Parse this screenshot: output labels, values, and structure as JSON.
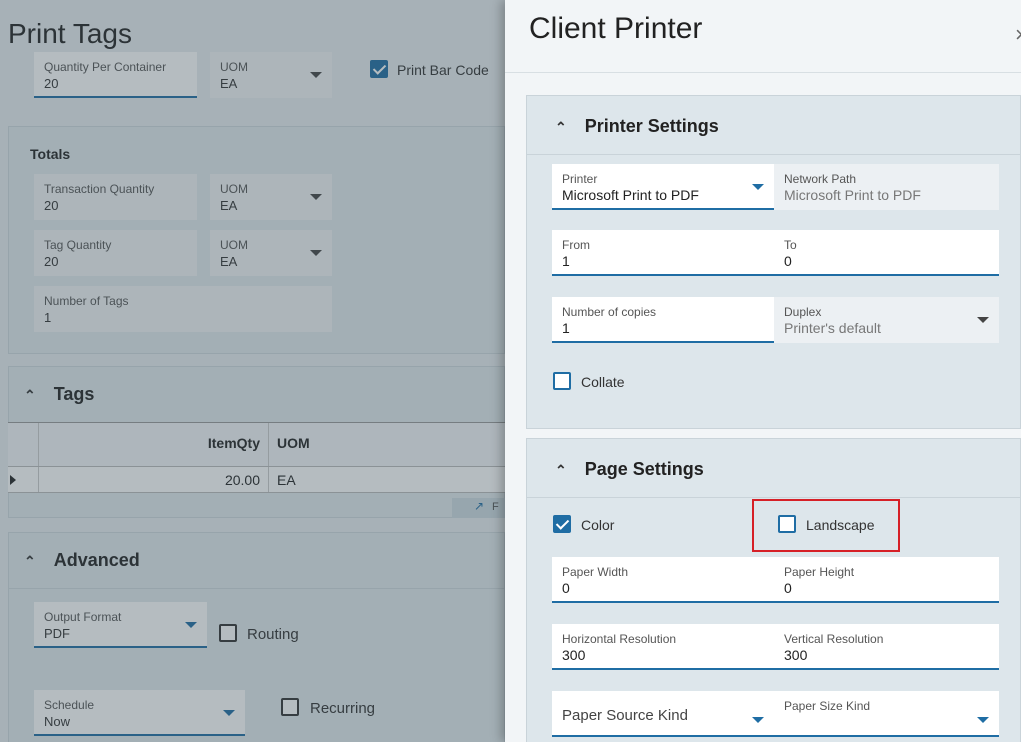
{
  "background": {
    "title": "Print Tags",
    "qty_per_container": {
      "label": "Quantity Per Container",
      "value": "20"
    },
    "uom_top": {
      "label": "UOM",
      "value": "EA"
    },
    "print_bar_code": {
      "label": "Print Bar Code",
      "checked": true
    },
    "totals": {
      "heading": "Totals",
      "transaction_quantity": {
        "label": "Transaction Quantity",
        "value": "20"
      },
      "uom1": {
        "label": "UOM",
        "value": "EA"
      },
      "tag_quantity": {
        "label": "Tag Quantity",
        "value": "20"
      },
      "uom2": {
        "label": "UOM",
        "value": "EA"
      },
      "number_of_tags": {
        "label": "Number of Tags",
        "value": "1"
      }
    },
    "tags": {
      "heading": "Tags",
      "columns": [
        "ItemQty",
        "UOM"
      ],
      "rows": [
        {
          "itemqty": "20.00",
          "uom": "EA"
        }
      ],
      "footer_text": "F"
    },
    "advanced": {
      "heading": "Advanced",
      "output_format": {
        "label": "Output Format",
        "value": "PDF"
      },
      "routing": {
        "label": "Routing",
        "checked": false
      },
      "schedule": {
        "label": "Schedule",
        "value": "Now"
      },
      "recurring": {
        "label": "Recurring",
        "checked": false
      }
    }
  },
  "panel": {
    "title": "Client Printer",
    "close_glyph": "×",
    "printer_settings": {
      "heading": "Printer Settings",
      "printer": {
        "label": "Printer",
        "value": "Microsoft Print to PDF"
      },
      "network_path": {
        "label": "Network Path",
        "value": "Microsoft Print to PDF"
      },
      "from": {
        "label": "From",
        "value": "1"
      },
      "to": {
        "label": "To",
        "value": "0"
      },
      "copies": {
        "label": "Number of copies",
        "value": "1"
      },
      "duplex": {
        "label": "Duplex",
        "value": "Printer's default"
      },
      "collate": {
        "label": "Collate",
        "checked": false
      }
    },
    "page_settings": {
      "heading": "Page Settings",
      "color": {
        "label": "Color",
        "checked": true
      },
      "landscape": {
        "label": "Landscape",
        "checked": false
      },
      "paper_width": {
        "label": "Paper Width",
        "value": "0"
      },
      "paper_height": {
        "label": "Paper Height",
        "value": "0"
      },
      "h_res": {
        "label": "Horizontal Resolution",
        "value": "300"
      },
      "v_res": {
        "label": "Vertical Resolution",
        "value": "300"
      },
      "paper_source": {
        "label": "Paper Source Kind",
        "value": ""
      },
      "paper_size": {
        "label": "Paper Size Kind",
        "value": ""
      }
    }
  },
  "colors": {
    "accent": "#1f6da4",
    "highlight": "#d62027"
  }
}
